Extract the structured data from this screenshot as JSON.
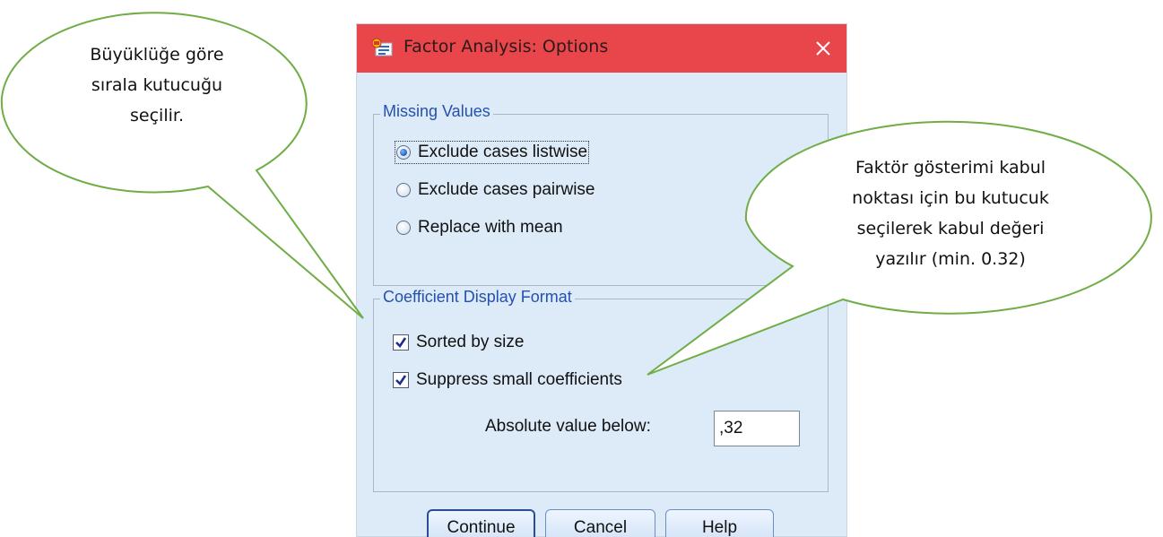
{
  "window": {
    "title": "Factor Analysis: Options",
    "icon": "spss-app-icon",
    "close_icon": "close-icon"
  },
  "missing_values": {
    "legend": "Missing Values",
    "options": [
      {
        "label": "Exclude cases listwise",
        "checked": true
      },
      {
        "label": "Exclude cases pairwise",
        "checked": false
      },
      {
        "label": "Replace with mean",
        "checked": false
      }
    ]
  },
  "coefficient_display": {
    "legend": "Coefficient Display Format",
    "sorted_by_size": {
      "label": "Sorted by size",
      "checked": true
    },
    "suppress_small": {
      "label": "Suppress small coefficients",
      "checked": true
    },
    "absolute_label": "Absolute value below:",
    "absolute_value": ",32"
  },
  "buttons": {
    "continue": "Continue",
    "cancel": "Cancel",
    "help": "Help"
  },
  "callouts": {
    "left": [
      "Büyüklüğe göre",
      "sırala kutucuğu",
      "seçilir."
    ],
    "right": [
      "Faktör gösterimi kabul",
      "noktası için bu kutucuk",
      "seçilerek kabul değeri",
      "yazılır (min. 0.32)"
    ]
  },
  "colors": {
    "titlebar": "#e8464b",
    "dialog_bg": "#ddeaf7",
    "legend_text": "#2450b0",
    "callout_border": "#70ad47"
  }
}
